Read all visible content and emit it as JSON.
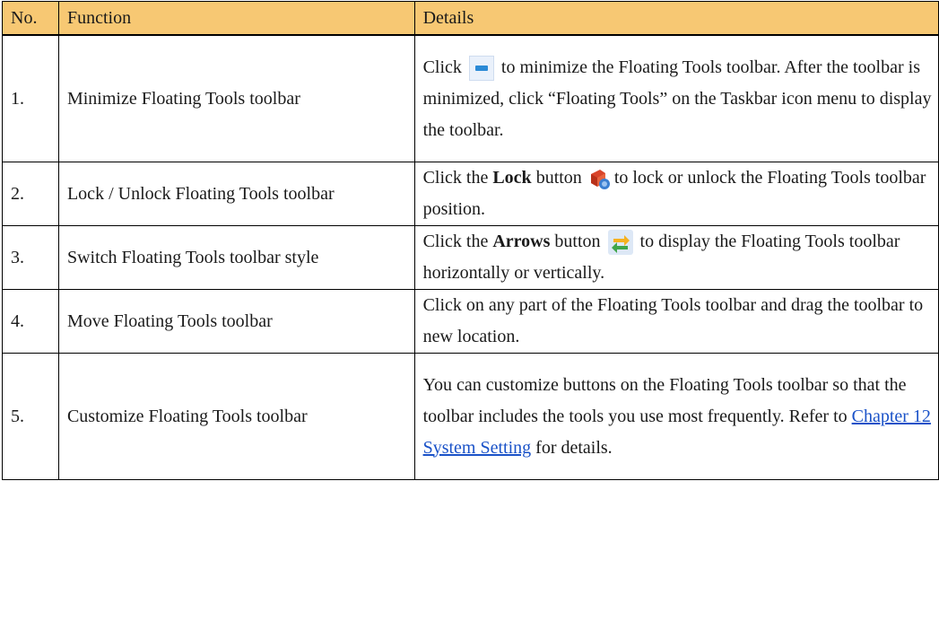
{
  "table": {
    "headers": {
      "no": "No.",
      "function": "Function",
      "details": "Details"
    },
    "rows": [
      {
        "no": "1.",
        "function": "Minimize Floating Tools toolbar",
        "details": {
          "pre": "Click",
          "icon": "minimize-icon",
          "post": "to minimize the Floating Tools toolbar. After the toolbar is minimized, click “Floating Tools” on the Taskbar icon menu to display the toolbar."
        }
      },
      {
        "no": "2.",
        "function": "Lock / Unlock Floating Tools toolbar",
        "details": {
          "pre": "Click the",
          "bold": "Lock",
          "mid": "button",
          "icon": "lock-icon",
          "post": "to lock or unlock the Floating Tools toolbar position."
        }
      },
      {
        "no": "3.",
        "function": "Switch Floating Tools toolbar style",
        "details": {
          "pre": "Click the",
          "bold": "Arrows",
          "mid": "button",
          "icon": "arrows-icon",
          "post": "to display the Floating Tools toolbar horizontally or vertically."
        }
      },
      {
        "no": "4.",
        "function": "Move Floating Tools toolbar",
        "details": {
          "text": "Click on any part of the Floating Tools toolbar and drag the toolbar to new location."
        }
      },
      {
        "no": "5.",
        "function": "Customize Floating Tools toolbar",
        "details": {
          "pre": "You can customize buttons on the Floating Tools toolbar so that the toolbar includes the tools you use most frequently. Refer to",
          "link": "Chapter 12 System Setting",
          "post": "for details."
        }
      }
    ]
  },
  "colors": {
    "header_bg": "#f7c873",
    "link": "#1a52c8",
    "minimize_icon": "#2b8ad6"
  }
}
